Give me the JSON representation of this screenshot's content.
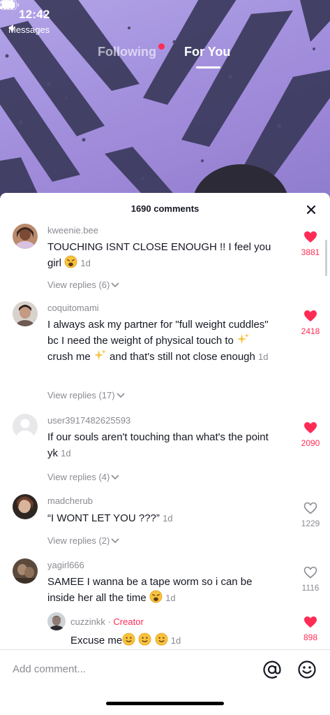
{
  "status": {
    "time": "12:42",
    "back_label": "Messages"
  },
  "feed_tabs": {
    "following": "Following",
    "for_you": "For You"
  },
  "comments_header": {
    "count_label": "1690 comments"
  },
  "comments": [
    {
      "user": "kweenie.bee",
      "text": "TOUCHING ISNT CLOSE ENOUGH !! I feel you girl",
      "date": "1d",
      "replies": "View replies (6)",
      "likes": "3881",
      "liked": true
    },
    {
      "user": "coquitomami",
      "text_a": "I always ask my partner for \"full weight cuddles\" bc I need the weight of physical touch to ",
      "text_b": "crush me",
      "text_c": " and that's still not close enough",
      "date": "1d",
      "replies": "View replies (17)",
      "likes": "2418",
      "liked": true
    },
    {
      "user": "user3917482625593",
      "text": "If our souls aren't touching than what's the point yk",
      "date": "1d",
      "replies": "View replies (4)",
      "likes": "2090",
      "liked": true
    },
    {
      "user": "madcherub",
      "text": "“I WONT LET YOU ???”",
      "date": "1d",
      "replies": "View replies (2)",
      "likes": "1229",
      "liked": false
    },
    {
      "user": "yagirl666",
      "text": "SAMEE I wanna be a tape worm so i can be inside her all the time",
      "date": "1d",
      "likes": "1116",
      "liked": false
    }
  ],
  "reply": {
    "user": "cuzzinkk",
    "separator": " · ",
    "badge": "Creator",
    "text": "Excuse me",
    "date": "1d",
    "likes": "898",
    "liked": true
  },
  "input": {
    "placeholder": "Add comment..."
  },
  "colors": {
    "accent": "#fe2c55",
    "muted": "#8a8b91",
    "text": "#161823"
  }
}
